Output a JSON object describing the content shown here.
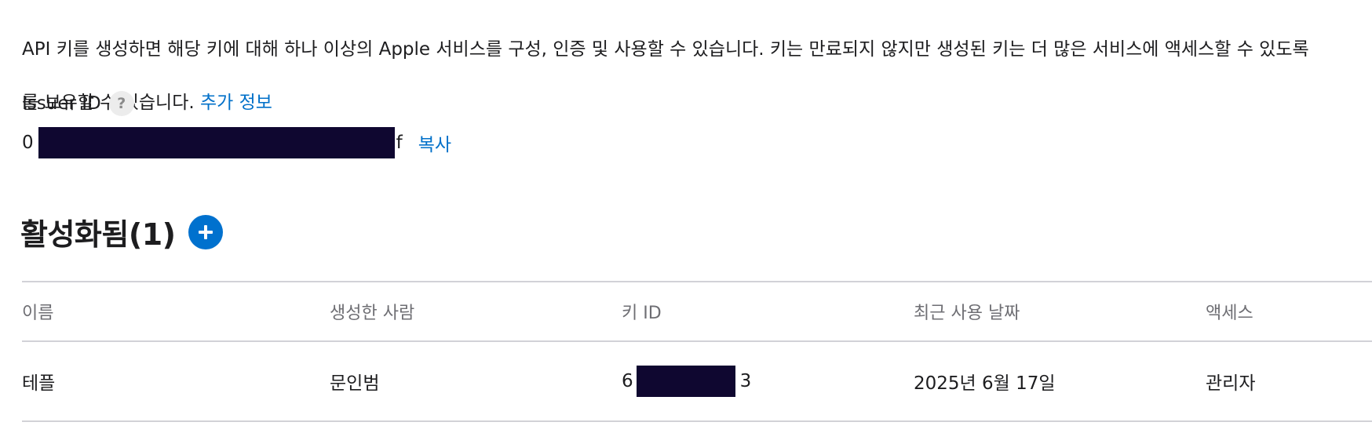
{
  "description": {
    "line1": "API 키를 생성하면 해당 키에 대해 하나 이상의 Apple 서비스를 구성, 인증 및 사용할 수 있습니다. 키는 만료되지 않지만 생성된 키는 더 많은 서비스에 액세스할 수 있도록",
    "line2_prefix": "를 보유할 수 있습니다. ",
    "more_info_link": "추가 정보"
  },
  "issuer": {
    "label": "Issuer ID",
    "help_icon": "?",
    "value_prefix": "0",
    "value_suffix": "f",
    "copy_label": "복사"
  },
  "active_section": {
    "title": "활성화됨(1)",
    "add_icon": "plus-icon"
  },
  "table": {
    "columns": [
      "이름",
      "생성한 사람",
      "키 ID",
      "최근 사용 날짜",
      "액세스"
    ],
    "rows": [
      {
        "name": "테플",
        "created_by": "문인범",
        "key_id_prefix": "6",
        "key_id_suffix": "3",
        "last_used": "2025년 6월 17일",
        "access": "관리자"
      }
    ]
  },
  "colors": {
    "link": "#0070c9",
    "add_button": "#0071ce",
    "redaction": "#0f0730"
  }
}
